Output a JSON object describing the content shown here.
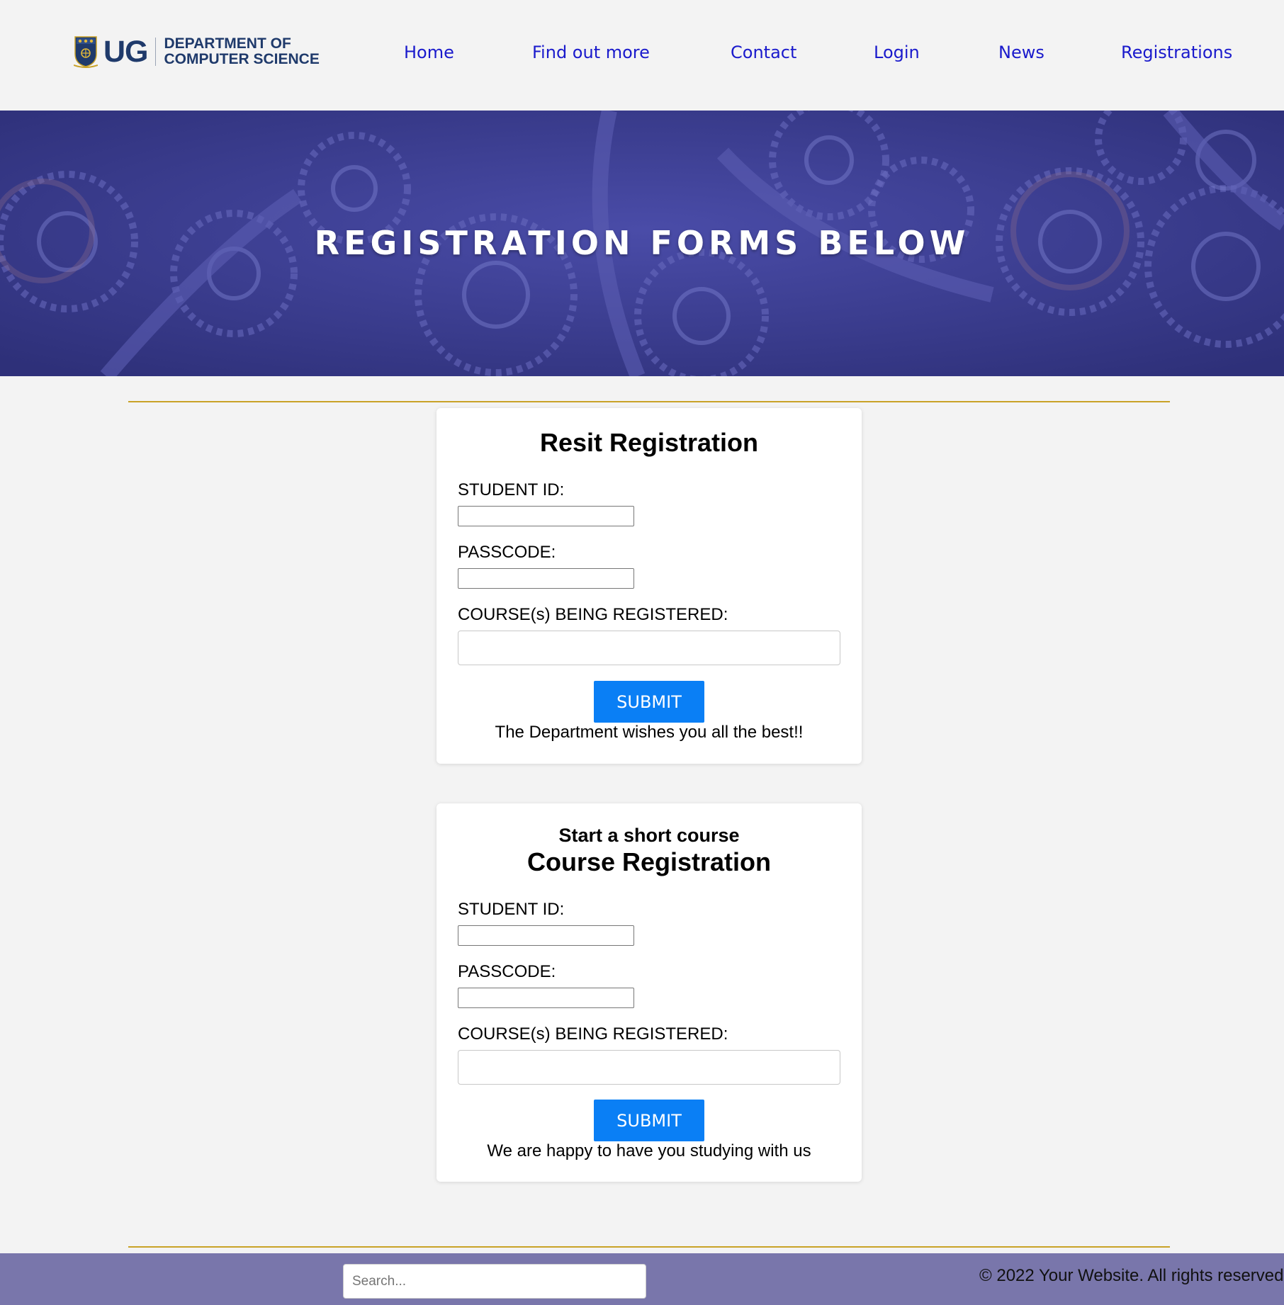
{
  "header": {
    "logo_mark": "UG",
    "logo_line1": "DEPARTMENT OF",
    "logo_line2": "COMPUTER SCIENCE",
    "nav": [
      "Home",
      "Find out more",
      "Contact",
      "Login",
      "News",
      "Registrations"
    ],
    "nav_color": "#1a1acc"
  },
  "hero": {
    "title": "REGISTRATION FORMS BELOW",
    "background": "#3b3d8f"
  },
  "resit_form": {
    "title": "Resit Registration",
    "student_id_label": "STUDENT ID:",
    "passcode_label": "PASSCODE:",
    "courses_label": "COURSE(s) BEING REGISTERED:",
    "student_id_value": "",
    "passcode_value": "",
    "courses_value": "",
    "submit_label": "SUBMIT",
    "note": "The Department wishes you all the best!!"
  },
  "course_form": {
    "subtitle": "Start a short course",
    "title": "Course Registration",
    "student_id_label": "STUDENT ID:",
    "passcode_label": "PASSCODE:",
    "courses_label": "COURSE(s) BEING REGISTERED:",
    "student_id_value": "",
    "passcode_value": "",
    "courses_value": "",
    "submit_label": "SUBMIT",
    "note": "We are happy to have you studying with us"
  },
  "footer": {
    "search_placeholder": "Search...",
    "copyright": "© 2022 Your Website. All rights reserved."
  },
  "colors": {
    "accent_button": "#0a7ff5",
    "divider_gold": "#c9a227",
    "footer_bg": "#7976ab"
  }
}
